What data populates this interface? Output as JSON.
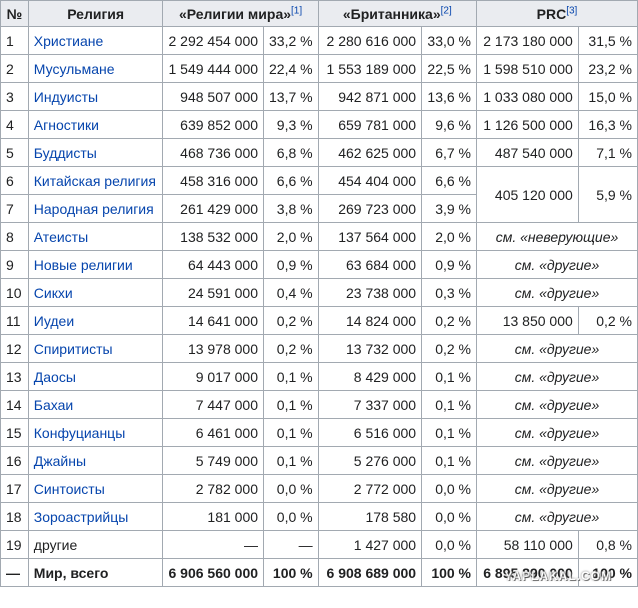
{
  "header": {
    "num": "№",
    "religion": "Религия",
    "src1": "«Религии мира»",
    "src1_ref": "[1]",
    "src2": "«Британника»",
    "src2_ref": "[2]",
    "src3": "PRC",
    "src3_ref": "[3]"
  },
  "rows": [
    {
      "n": "1",
      "name": "Христиане",
      "v1": "2 292 454 000",
      "p1": "33,2 %",
      "v2": "2 280 616 000",
      "p2": "33,0 %",
      "v3": "2 173 180 000",
      "p3": "31,5 %"
    },
    {
      "n": "2",
      "name": "Мусульмане",
      "v1": "1 549 444 000",
      "p1": "22,4 %",
      "v2": "1 553 189 000",
      "p2": "22,5 %",
      "v3": "1 598 510 000",
      "p3": "23,2 %"
    },
    {
      "n": "3",
      "name": "Индуисты",
      "v1": "948 507 000",
      "p1": "13,7 %",
      "v2": "942 871 000",
      "p2": "13,6 %",
      "v3": "1 033 080 000",
      "p3": "15,0 %"
    },
    {
      "n": "4",
      "name": "Агностики",
      "v1": "639 852 000",
      "p1": "9,3 %",
      "v2": "659 781 000",
      "p2": "9,6 %",
      "v3": "1 126 500 000",
      "p3": "16,3 %"
    },
    {
      "n": "5",
      "name": "Буддисты",
      "v1": "468 736 000",
      "p1": "6,8 %",
      "v2": "462 625 000",
      "p2": "6,7 %",
      "v3": "487 540 000",
      "p3": "7,1 %"
    },
    {
      "n": "6",
      "name": "Китайская религия",
      "v1": "458 316 000",
      "p1": "6,6 %",
      "v2": "454 404 000",
      "p2": "6,6 %",
      "v3": "405 120 000",
      "p3": "5,9 %"
    },
    {
      "n": "7",
      "name": "Народная религия",
      "v1": "261 429 000",
      "p1": "3,8 %",
      "v2": "269 723 000",
      "p2": "3,9 %"
    },
    {
      "n": "8",
      "name": "Атеисты",
      "v1": "138 532 000",
      "p1": "2,0 %",
      "v2": "137 564 000",
      "p2": "2,0 %",
      "see": "см. «неверующие»"
    },
    {
      "n": "9",
      "name": "Новые религии",
      "v1": "64 443 000",
      "p1": "0,9 %",
      "v2": "63 684 000",
      "p2": "0,9 %",
      "see": "см. «другие»"
    },
    {
      "n": "10",
      "name": "Сикхи",
      "v1": "24 591 000",
      "p1": "0,4 %",
      "v2": "23 738 000",
      "p2": "0,3 %",
      "see": "см. «другие»"
    },
    {
      "n": "11",
      "name": "Иудеи",
      "v1": "14 641 000",
      "p1": "0,2 %",
      "v2": "14 824 000",
      "p2": "0,2 %",
      "v3": "13 850 000",
      "p3": "0,2 %"
    },
    {
      "n": "12",
      "name": "Спиритисты",
      "v1": "13 978 000",
      "p1": "0,2 %",
      "v2": "13 732 000",
      "p2": "0,2 %",
      "see": "см. «другие»"
    },
    {
      "n": "13",
      "name": "Даосы",
      "v1": "9 017 000",
      "p1": "0,1 %",
      "v2": "8 429 000",
      "p2": "0,1 %",
      "see": "см. «другие»"
    },
    {
      "n": "14",
      "name": "Бахаи",
      "v1": "7 447 000",
      "p1": "0,1 %",
      "v2": "7 337 000",
      "p2": "0,1 %",
      "see": "см. «другие»"
    },
    {
      "n": "15",
      "name": "Конфуцианцы",
      "v1": "6 461 000",
      "p1": "0,1 %",
      "v2": "6 516 000",
      "p2": "0,1 %",
      "see": "см. «другие»"
    },
    {
      "n": "16",
      "name": "Джайны",
      "v1": "5 749 000",
      "p1": "0,1 %",
      "v2": "5 276 000",
      "p2": "0,1 %",
      "see": "см. «другие»"
    },
    {
      "n": "17",
      "name": "Синтоисты",
      "v1": "2 782 000",
      "p1": "0,0 %",
      "v2": "2 772 000",
      "p2": "0,0 %",
      "see": "см. «другие»"
    },
    {
      "n": "18",
      "name": "Зороастрийцы",
      "v1": "181 000",
      "p1": "0,0 %",
      "v2": "178 580",
      "p2": "0,0 %",
      "see": "см. «другие»"
    },
    {
      "n": "19",
      "name": "другие",
      "v1": "—",
      "p1": "—",
      "v2": "1 427 000",
      "p2": "0,0 %",
      "v3": "58 110 000",
      "p3": "0,8 %"
    }
  ],
  "total": {
    "n": "—",
    "name": "Мир, всего",
    "v1": "6 906 560 000",
    "p1": "100 %",
    "v2": "6 908 689 000",
    "p2": "100 %",
    "v3": "6 895 890 000",
    "p3": "100 %"
  },
  "watermark": "YAPLAKAL.COM"
}
